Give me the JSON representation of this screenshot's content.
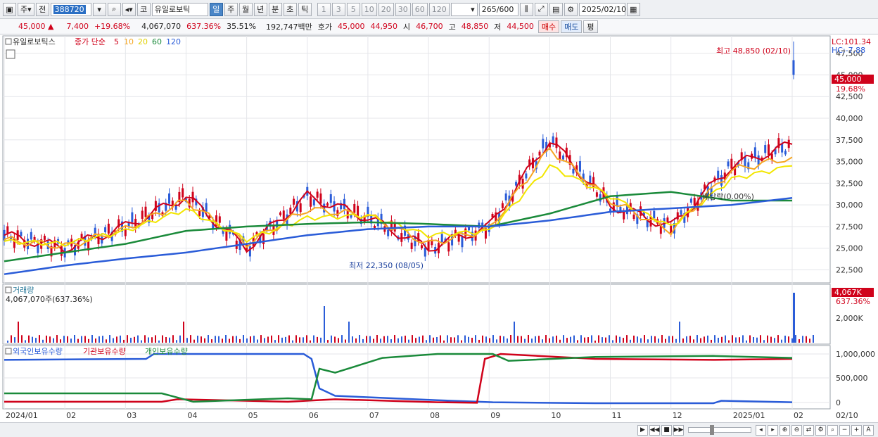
{
  "toolbar": {
    "market_label": "주",
    "prev_label": "전",
    "stock_code": "388720",
    "stock_prefix": "코",
    "stock_name": "유일로보틱",
    "periods": [
      "일",
      "주",
      "월",
      "년",
      "분",
      "초",
      "틱"
    ],
    "active_period": "일",
    "intervals": [
      "1",
      "3",
      "5",
      "10",
      "20",
      "30",
      "60",
      "120"
    ],
    "count": "265",
    "count_max": "/600",
    "date": "2025/02/10"
  },
  "quote": {
    "price": "45,000",
    "change": "7,400",
    "change_pct": "+19.68%",
    "volume": "4,067,070",
    "volume_ratio": "637.36%",
    "rotation": "35.51%",
    "amount": "192,747백만",
    "bid_label": "호가",
    "bid": "45,000",
    "ask": "44,950",
    "open_label": "시",
    "open": "46,700",
    "high_label": "고",
    "high": "48,850",
    "low_label": "저",
    "low": "44,500",
    "buy_label": "매수",
    "sell_label": "매도",
    "avg_label": "평"
  },
  "price_panel": {
    "stock_tag": "유일로보틱스",
    "ma_label": "종가 단순",
    "ma_periods": [
      "5",
      "10",
      "20",
      "60",
      "120"
    ],
    "ma_colors": [
      "#d0021b",
      "#f5a623",
      "#f2e600",
      "#1a8a3a",
      "#2a5cd8"
    ],
    "lc": "LC:101.34",
    "hc": "HC:-7.88",
    "yaxis": [
      "47,500",
      "45,000",
      "42,500",
      "40,000",
      "37,500",
      "35,000",
      "32,500",
      "30,000",
      "27,500",
      "25,000",
      "22,500"
    ],
    "current_price": "45,000",
    "current_pct": "19.68%",
    "high_note": "최고 48,850 (02/10)",
    "low_note": "최저 22,350 (08/05)",
    "dividend_note": "배당락(0.00%)"
  },
  "volume_panel": {
    "title": "거래량",
    "value": "4,067,070주(637.36%)",
    "axis": [
      "2,000K"
    ],
    "current": "4,067K",
    "current_pct": "637.36%"
  },
  "flow_panel": {
    "legend": [
      "외국인보유수량",
      "기관보유수량",
      "개인보유수량"
    ],
    "colors": [
      "#2a5cd8",
      "#d0021b",
      "#1a8a3a"
    ],
    "axis": [
      "1,000,000",
      "500,000",
      "0"
    ]
  },
  "xaxis": [
    "2024/01",
    "02",
    "03",
    "04",
    "05",
    "06",
    "07",
    "08",
    "09",
    "10",
    "11",
    "12",
    "2025/01",
    "02"
  ],
  "xaxis_right": "02/10",
  "chart_data": {
    "type": "line",
    "title": "유일로보틱스",
    "x": [
      "2024/01",
      "02",
      "03",
      "04",
      "05",
      "06",
      "07",
      "08",
      "09",
      "10",
      "11",
      "12",
      "2025/01",
      "02"
    ],
    "ylim": [
      21000,
      49500
    ],
    "series": [
      {
        "name": "5",
        "values": [
          26500,
          25000,
          27500,
          31000,
          25000,
          31000,
          28500,
          25000,
          27500,
          37500,
          30000,
          27500,
          34500,
          37000
        ]
      },
      {
        "name": "10",
        "values": [
          26000,
          25200,
          27200,
          30500,
          25500,
          29500,
          28800,
          25500,
          27200,
          36500,
          30500,
          27000,
          34000,
          35500
        ]
      },
      {
        "name": "20",
        "values": [
          25800,
          25500,
          27000,
          29500,
          26000,
          28500,
          28800,
          26500,
          27000,
          34500,
          31000,
          27500,
          33000,
          34500
        ]
      },
      {
        "name": "60",
        "values": [
          23500,
          24500,
          25500,
          27000,
          27500,
          27800,
          28000,
          27800,
          27500,
          29000,
          31000,
          31500,
          30500,
          30500
        ]
      },
      {
        "name": "120",
        "values": [
          22000,
          23000,
          23800,
          24500,
          25500,
          26500,
          27200,
          27500,
          27500,
          28200,
          29200,
          29600,
          30000,
          30800
        ]
      }
    ],
    "high": {
      "value": 48850,
      "date": "02/10"
    },
    "low": {
      "value": 22350,
      "date": "08/05"
    }
  }
}
